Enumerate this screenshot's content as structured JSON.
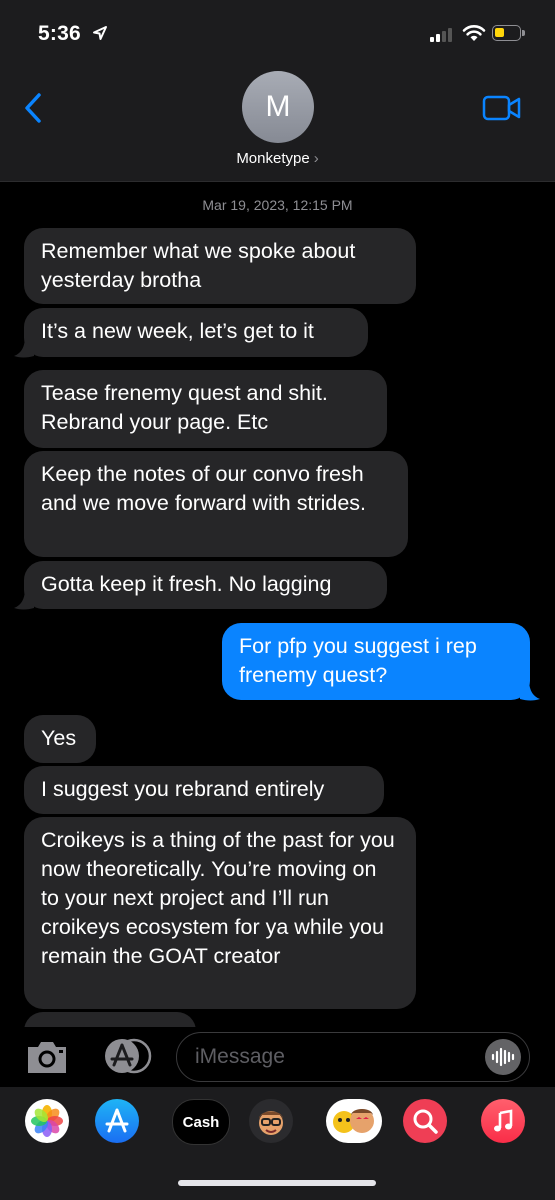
{
  "status_bar": {
    "time": "5:36"
  },
  "header": {
    "avatar_initial": "M",
    "contact_name": "Monketype",
    "contact_chevron": "›"
  },
  "thread": {
    "timestamp": "Mar 19, 2023, 12:15 PM",
    "messages": [
      {
        "text": "Remember what we spoke about yesterday brotha",
        "direction": "in"
      },
      {
        "text": "It’s a new week, let’s get to it",
        "direction": "in"
      },
      {
        "text": "Tease frenemy quest and shit. Rebrand your page. Etc",
        "direction": "in"
      },
      {
        "text": "Keep the notes of our convo fresh and we move forward with strides.",
        "direction": "in"
      },
      {
        "text": "Gotta keep it fresh. No lagging",
        "direction": "in"
      },
      {
        "text": "For pfp you suggest i rep frenemy quest?",
        "direction": "out"
      },
      {
        "text": "Yes",
        "direction": "in"
      },
      {
        "text": "I suggest you rebrand entirely",
        "direction": "in"
      },
      {
        "text": "Croikeys is a thing of the past for you now theoretically. You’re moving on to your next project and I’ll run croikeys ecosystem for ya while you remain the GOAT creator",
        "direction": "in"
      }
    ]
  },
  "compose": {
    "placeholder": "iMessage"
  },
  "app_drawer": {
    "apps": [
      {
        "name": "photos-app-icon"
      },
      {
        "name": "app-store-app-icon"
      },
      {
        "name": "apple-cash-app-icon",
        "label": "Cash"
      },
      {
        "name": "memoji-app-icon"
      },
      {
        "name": "memoji-stickers-app-icon"
      },
      {
        "name": "search-images-app-icon"
      },
      {
        "name": "music-app-icon"
      }
    ]
  },
  "colors": {
    "incoming_bubble": "#262628",
    "outgoing_bubble": "#0a84ff",
    "accent": "#0a84ff",
    "background": "#000000",
    "header": "#1c1c1e"
  }
}
